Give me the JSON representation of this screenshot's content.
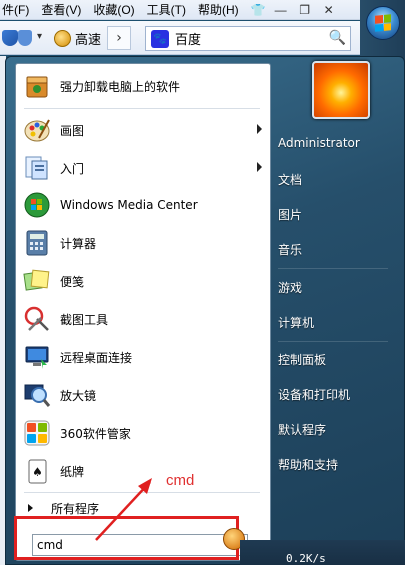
{
  "browser": {
    "menu": [
      "件(F)",
      "查看(V)",
      "收藏(O)",
      "工具(T)",
      "帮助(H)"
    ],
    "toolbar": {
      "speedup_label": "高速",
      "search_engine": "百度"
    }
  },
  "start_menu": {
    "programs": [
      {
        "label": "强力卸载电脑上的软件",
        "icon": "uninstall-box-icon",
        "submenu": false
      },
      {
        "label": "画图",
        "icon": "paint-palette-icon",
        "submenu": true
      },
      {
        "label": "入门",
        "icon": "getting-started-icon",
        "submenu": true
      },
      {
        "label": "Windows Media Center",
        "icon": "windows-media-center-icon",
        "submenu": false
      },
      {
        "label": "计算器",
        "icon": "calculator-icon",
        "submenu": false
      },
      {
        "label": "便笺",
        "icon": "sticky-notes-icon",
        "submenu": false
      },
      {
        "label": "截图工具",
        "icon": "snipping-tool-icon",
        "submenu": false
      },
      {
        "label": "远程桌面连接",
        "icon": "remote-desktop-icon",
        "submenu": false
      },
      {
        "label": "放大镜",
        "icon": "magnifier-icon",
        "submenu": false
      },
      {
        "label": "360软件管家",
        "icon": "360-software-manager-icon",
        "submenu": false
      },
      {
        "label": "纸牌",
        "icon": "solitaire-icon",
        "submenu": false
      }
    ],
    "all_programs": "所有程序",
    "search_value": "cmd",
    "right_items": [
      "Administrator",
      "文档",
      "图片",
      "音乐",
      "游戏",
      "计算机",
      "控制面板",
      "设备和打印机",
      "默认程序",
      "帮助和支持"
    ]
  },
  "annotation": {
    "text": "cmd"
  },
  "status": {
    "net_speed": "0.2K/s"
  },
  "colors": {
    "accent_red": "#e02020",
    "menu_blue": "#264f6b"
  }
}
